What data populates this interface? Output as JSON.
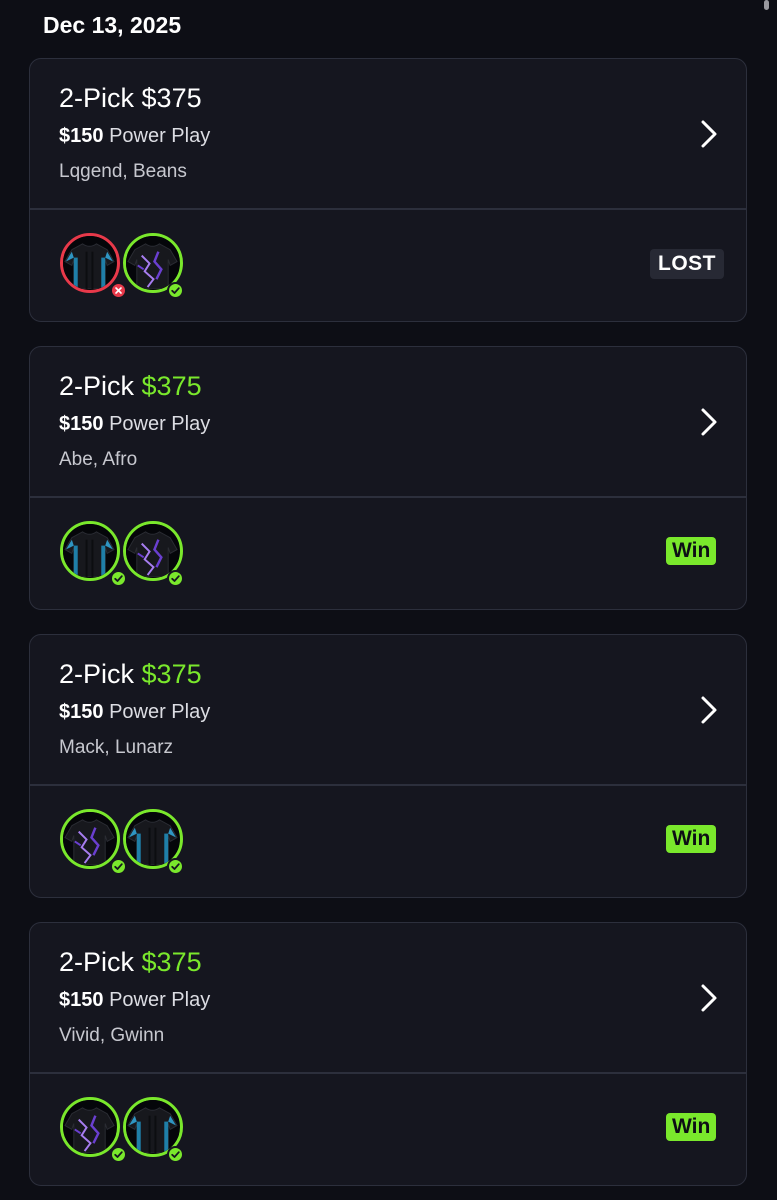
{
  "date_header": "Dec 13, 2025",
  "colors": {
    "background": "#0d0e15",
    "card": "#15161f",
    "accent_green": "#7ae82c",
    "lost_red": "#e8394a"
  },
  "entries": [
    {
      "title_prefix": "2-Pick",
      "payout": "$375",
      "payout_style": "white",
      "entry_amount": "$150",
      "entry_type": "Power Play",
      "players": "Lqgend, Beans",
      "picks": [
        {
          "jersey": "blue-jersey",
          "result": "lost"
        },
        {
          "jersey": "purple-jersey",
          "result": "won"
        }
      ],
      "status": "LOST"
    },
    {
      "title_prefix": "2-Pick",
      "payout": "$375",
      "payout_style": "green",
      "entry_amount": "$150",
      "entry_type": "Power Play",
      "players": "Abe, Afro",
      "picks": [
        {
          "jersey": "blue-jersey",
          "result": "won"
        },
        {
          "jersey": "purple-jersey",
          "result": "won"
        }
      ],
      "status": "Win"
    },
    {
      "title_prefix": "2-Pick",
      "payout": "$375",
      "payout_style": "green",
      "entry_amount": "$150",
      "entry_type": "Power Play",
      "players": "Mack, Lunarz",
      "picks": [
        {
          "jersey": "purple-jersey",
          "result": "won"
        },
        {
          "jersey": "blue-jersey",
          "result": "won"
        }
      ],
      "status": "Win"
    },
    {
      "title_prefix": "2-Pick",
      "payout": "$375",
      "payout_style": "green",
      "entry_amount": "$150",
      "entry_type": "Power Play",
      "players": "Vivid, Gwinn",
      "picks": [
        {
          "jersey": "purple-jersey",
          "result": "won"
        },
        {
          "jersey": "blue-jersey",
          "result": "won"
        }
      ],
      "status": "Win"
    }
  ]
}
